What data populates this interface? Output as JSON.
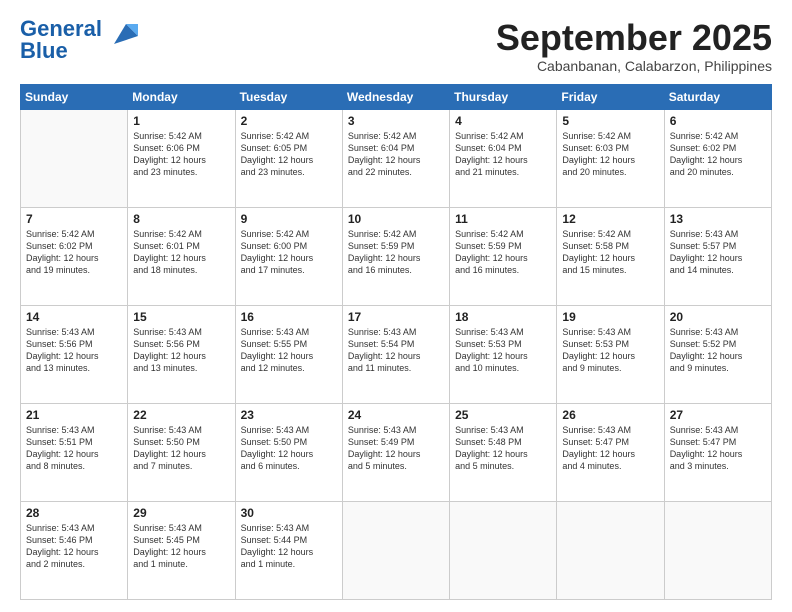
{
  "header": {
    "logo_line1": "General",
    "logo_line2": "Blue",
    "title": "September 2025",
    "subtitle": "Cabanbanan, Calabarzon, Philippines"
  },
  "weekdays": [
    "Sunday",
    "Monday",
    "Tuesday",
    "Wednesday",
    "Thursday",
    "Friday",
    "Saturday"
  ],
  "weeks": [
    [
      {
        "day": "",
        "content": ""
      },
      {
        "day": "1",
        "content": "Sunrise: 5:42 AM\nSunset: 6:06 PM\nDaylight: 12 hours\nand 23 minutes."
      },
      {
        "day": "2",
        "content": "Sunrise: 5:42 AM\nSunset: 6:05 PM\nDaylight: 12 hours\nand 23 minutes."
      },
      {
        "day": "3",
        "content": "Sunrise: 5:42 AM\nSunset: 6:04 PM\nDaylight: 12 hours\nand 22 minutes."
      },
      {
        "day": "4",
        "content": "Sunrise: 5:42 AM\nSunset: 6:04 PM\nDaylight: 12 hours\nand 21 minutes."
      },
      {
        "day": "5",
        "content": "Sunrise: 5:42 AM\nSunset: 6:03 PM\nDaylight: 12 hours\nand 20 minutes."
      },
      {
        "day": "6",
        "content": "Sunrise: 5:42 AM\nSunset: 6:02 PM\nDaylight: 12 hours\nand 20 minutes."
      }
    ],
    [
      {
        "day": "7",
        "content": "Sunrise: 5:42 AM\nSunset: 6:02 PM\nDaylight: 12 hours\nand 19 minutes."
      },
      {
        "day": "8",
        "content": "Sunrise: 5:42 AM\nSunset: 6:01 PM\nDaylight: 12 hours\nand 18 minutes."
      },
      {
        "day": "9",
        "content": "Sunrise: 5:42 AM\nSunset: 6:00 PM\nDaylight: 12 hours\nand 17 minutes."
      },
      {
        "day": "10",
        "content": "Sunrise: 5:42 AM\nSunset: 5:59 PM\nDaylight: 12 hours\nand 16 minutes."
      },
      {
        "day": "11",
        "content": "Sunrise: 5:42 AM\nSunset: 5:59 PM\nDaylight: 12 hours\nand 16 minutes."
      },
      {
        "day": "12",
        "content": "Sunrise: 5:42 AM\nSunset: 5:58 PM\nDaylight: 12 hours\nand 15 minutes."
      },
      {
        "day": "13",
        "content": "Sunrise: 5:43 AM\nSunset: 5:57 PM\nDaylight: 12 hours\nand 14 minutes."
      }
    ],
    [
      {
        "day": "14",
        "content": "Sunrise: 5:43 AM\nSunset: 5:56 PM\nDaylight: 12 hours\nand 13 minutes."
      },
      {
        "day": "15",
        "content": "Sunrise: 5:43 AM\nSunset: 5:56 PM\nDaylight: 12 hours\nand 13 minutes."
      },
      {
        "day": "16",
        "content": "Sunrise: 5:43 AM\nSunset: 5:55 PM\nDaylight: 12 hours\nand 12 minutes."
      },
      {
        "day": "17",
        "content": "Sunrise: 5:43 AM\nSunset: 5:54 PM\nDaylight: 12 hours\nand 11 minutes."
      },
      {
        "day": "18",
        "content": "Sunrise: 5:43 AM\nSunset: 5:53 PM\nDaylight: 12 hours\nand 10 minutes."
      },
      {
        "day": "19",
        "content": "Sunrise: 5:43 AM\nSunset: 5:53 PM\nDaylight: 12 hours\nand 9 minutes."
      },
      {
        "day": "20",
        "content": "Sunrise: 5:43 AM\nSunset: 5:52 PM\nDaylight: 12 hours\nand 9 minutes."
      }
    ],
    [
      {
        "day": "21",
        "content": "Sunrise: 5:43 AM\nSunset: 5:51 PM\nDaylight: 12 hours\nand 8 minutes."
      },
      {
        "day": "22",
        "content": "Sunrise: 5:43 AM\nSunset: 5:50 PM\nDaylight: 12 hours\nand 7 minutes."
      },
      {
        "day": "23",
        "content": "Sunrise: 5:43 AM\nSunset: 5:50 PM\nDaylight: 12 hours\nand 6 minutes."
      },
      {
        "day": "24",
        "content": "Sunrise: 5:43 AM\nSunset: 5:49 PM\nDaylight: 12 hours\nand 5 minutes."
      },
      {
        "day": "25",
        "content": "Sunrise: 5:43 AM\nSunset: 5:48 PM\nDaylight: 12 hours\nand 5 minutes."
      },
      {
        "day": "26",
        "content": "Sunrise: 5:43 AM\nSunset: 5:47 PM\nDaylight: 12 hours\nand 4 minutes."
      },
      {
        "day": "27",
        "content": "Sunrise: 5:43 AM\nSunset: 5:47 PM\nDaylight: 12 hours\nand 3 minutes."
      }
    ],
    [
      {
        "day": "28",
        "content": "Sunrise: 5:43 AM\nSunset: 5:46 PM\nDaylight: 12 hours\nand 2 minutes."
      },
      {
        "day": "29",
        "content": "Sunrise: 5:43 AM\nSunset: 5:45 PM\nDaylight: 12 hours\nand 1 minute."
      },
      {
        "day": "30",
        "content": "Sunrise: 5:43 AM\nSunset: 5:44 PM\nDaylight: 12 hours\nand 1 minute."
      },
      {
        "day": "",
        "content": ""
      },
      {
        "day": "",
        "content": ""
      },
      {
        "day": "",
        "content": ""
      },
      {
        "day": "",
        "content": ""
      }
    ]
  ]
}
